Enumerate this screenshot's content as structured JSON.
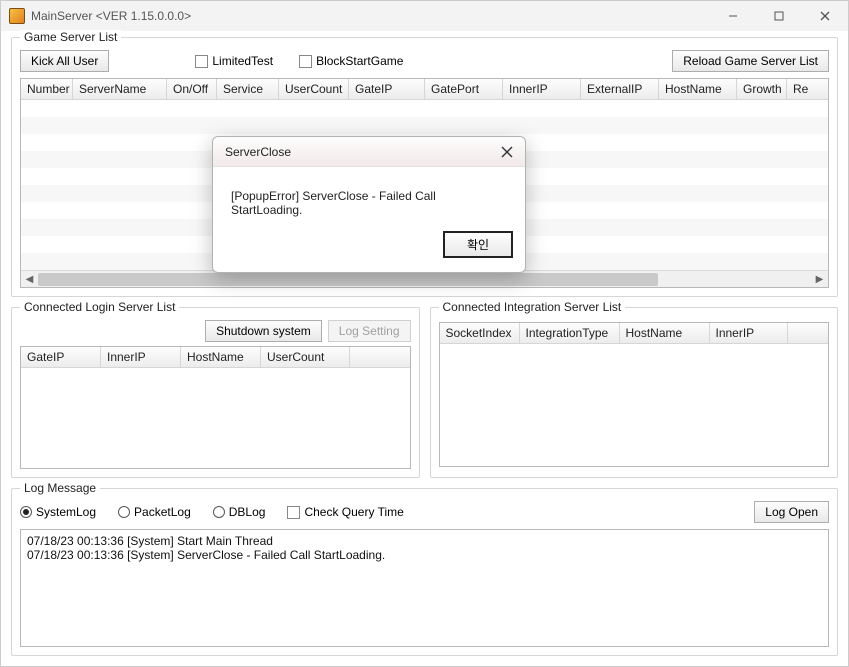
{
  "window": {
    "title": "MainServer <VER 1.15.0.0.0>"
  },
  "gameServerList": {
    "legend": "Game Server List",
    "kickAll": "Kick All User",
    "limitedTest": "LimitedTest",
    "blockStartGame": "BlockStartGame",
    "reload": "Reload Game Server List",
    "columns": [
      "Number",
      "ServerName",
      "On/Off",
      "Service",
      "UserCount",
      "GateIP",
      "GatePort",
      "InnerIP",
      "ExternalIP",
      "HostName",
      "Growth",
      "Re"
    ]
  },
  "loginServerList": {
    "legend": "Connected Login Server List",
    "shutdown": "Shutdown system",
    "logSetting": "Log Setting",
    "columns": [
      "GateIP",
      "InnerIP",
      "HostName",
      "UserCount"
    ]
  },
  "integrationServerList": {
    "legend": "Connected Integration Server List",
    "columns": [
      "SocketIndex",
      "IntegrationType",
      "HostName",
      "InnerIP"
    ]
  },
  "logMessage": {
    "legend": "Log Message",
    "radios": {
      "system": "SystemLog",
      "packet": "PacketLog",
      "db": "DBLog"
    },
    "checkQueryTime": "Check Query Time",
    "logOpen": "Log Open",
    "lines": [
      "07/18/23 00:13:36 [System] Start Main Thread",
      "07/18/23 00:13:36 [System] ServerClose - Failed Call StartLoading."
    ]
  },
  "dialog": {
    "title": "ServerClose",
    "message": "[PopupError] ServerClose - Failed Call StartLoading.",
    "ok": "확인"
  }
}
